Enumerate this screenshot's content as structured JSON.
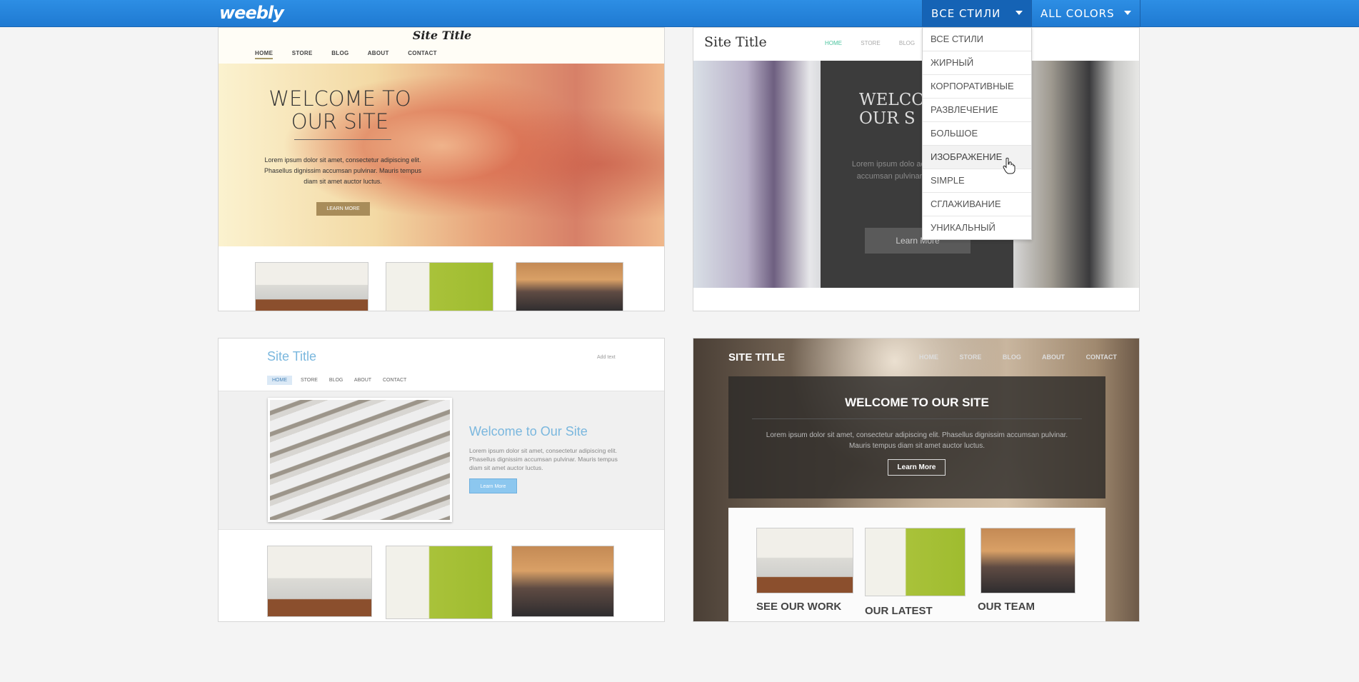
{
  "app": {
    "logo": "weebly"
  },
  "filters": {
    "styles_label": "ВСЕ СТИЛИ",
    "colors_label": "ALL COLORS",
    "styles_options": [
      "ВСЕ СТИЛИ",
      "ЖИРНЫЙ",
      "КОРПОРАТИВНЫЕ",
      "РАЗВЛЕЧЕНИЕ",
      "БОЛЬШОЕ",
      "ИЗОБРАЖЕНИЕ",
      "SIMPLE",
      "СГЛАЖИВАНИЕ",
      "УНИКАЛЬНЫЙ"
    ],
    "hovered_option": "ИЗОБРАЖЕНИЕ"
  },
  "themes": [
    {
      "site_title": "Site Title",
      "nav": [
        "HOME",
        "STORE",
        "BLOG",
        "ABOUT",
        "CONTACT"
      ],
      "heading_line1": "WELCOME TO",
      "heading_line2": "OUR SITE",
      "body": "Lorem ipsum dolor sit amet, consectetur adipiscing elit. Phasellus dignissim accumsan pulvinar. Mauris tempus diam sit amet auctor luctus.",
      "button": "LEARN MORE"
    },
    {
      "site_title": "Site Title",
      "nav": [
        "HOME",
        "STORE",
        "BLOG"
      ],
      "heading_line1": "WELCO",
      "heading_line2": "OUR S",
      "body": "Lorem ipsum dolo adipiscing elit. Pha accumsan pulvinar. M sit amet auc",
      "button": "Learn More"
    },
    {
      "site_title": "Site Title",
      "add_text": "Add text",
      "nav": [
        "HOME",
        "STORE",
        "BLOG",
        "ABOUT",
        "CONTACT"
      ],
      "heading": "Welcome to Our Site",
      "body": "Lorem ipsum dolor sit amet, consectetur adipiscing elit. Phasellus dignissim accumsan pulvinar. Mauris tempus diam sit amet auctor luctus.",
      "button": "Learn More"
    },
    {
      "site_title": "SITE TITLE",
      "nav": [
        "HOME",
        "STORE",
        "BLOG",
        "ABOUT",
        "CONTACT"
      ],
      "heading": "WELCOME TO OUR SITE",
      "body": "Lorem ipsum dolor sit amet, consectetur adipiscing elit. Phasellus dignissim accumsan pulvinar. Mauris tempus diam sit amet auctor luctus.",
      "button": "Learn More",
      "captions": [
        "SEE OUR WORK",
        "OUR LATEST",
        "OUR TEAM"
      ]
    }
  ],
  "colors": {
    "topbar": "#2d8ee4",
    "accent_green": "#4cc49f",
    "accent_blue": "#7ab7de"
  }
}
